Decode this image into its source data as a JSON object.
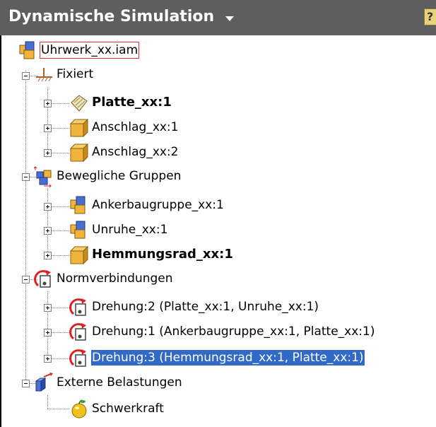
{
  "header": {
    "title": "Dynamische Simulation",
    "help_label": "?"
  },
  "tree": {
    "root": {
      "label": "Uhrwerk_xx.iam",
      "icon": "assembly-icon"
    },
    "groups": [
      {
        "label": "Fixiert",
        "icon": "ground-icon",
        "expanded": true,
        "children": [
          {
            "label": "Platte_xx:1",
            "icon": "part-hatched-icon",
            "bold": true
          },
          {
            "label": "Anschlag_xx:1",
            "icon": "part-icon"
          },
          {
            "label": "Anschlag_xx:2",
            "icon": "part-icon"
          }
        ]
      },
      {
        "label": "Bewegliche Gruppen",
        "icon": "mobile-groups-icon",
        "expanded": true,
        "children": [
          {
            "label": "Ankerbaugruppe_xx:1",
            "icon": "assembly-icon"
          },
          {
            "label": "Unruhe_xx:1",
            "icon": "assembly-icon"
          },
          {
            "label": "Hemmungsrad_xx:1",
            "icon": "part-icon",
            "bold": true
          }
        ]
      },
      {
        "label": "Normverbindungen",
        "icon": "joint-icon",
        "expanded": true,
        "children": [
          {
            "label": "Drehung:2 (Platte_xx:1, Unruhe_xx:1)",
            "icon": "joint-icon"
          },
          {
            "label": "Drehung:1 (Ankerbaugruppe_xx:1, Platte_xx:1)",
            "icon": "joint-icon"
          },
          {
            "label": "Drehung:3 (Hemmungsrad_xx:1, Platte_xx:1)",
            "icon": "joint-icon",
            "selected": true
          }
        ]
      },
      {
        "label": "Externe Belastungen",
        "icon": "external-loads-icon",
        "expanded": true,
        "children": [
          {
            "label": "Schwerkraft",
            "icon": "gravity-icon",
            "leaf": true
          }
        ]
      }
    ]
  },
  "colors": {
    "header_bg": "#5e5e5e",
    "selection": "#3169c6",
    "root_outline": "#e03030",
    "part_yellow": "#f0b43c",
    "assembly_blue": "#4a6fd0",
    "joint_red": "#e02020"
  }
}
